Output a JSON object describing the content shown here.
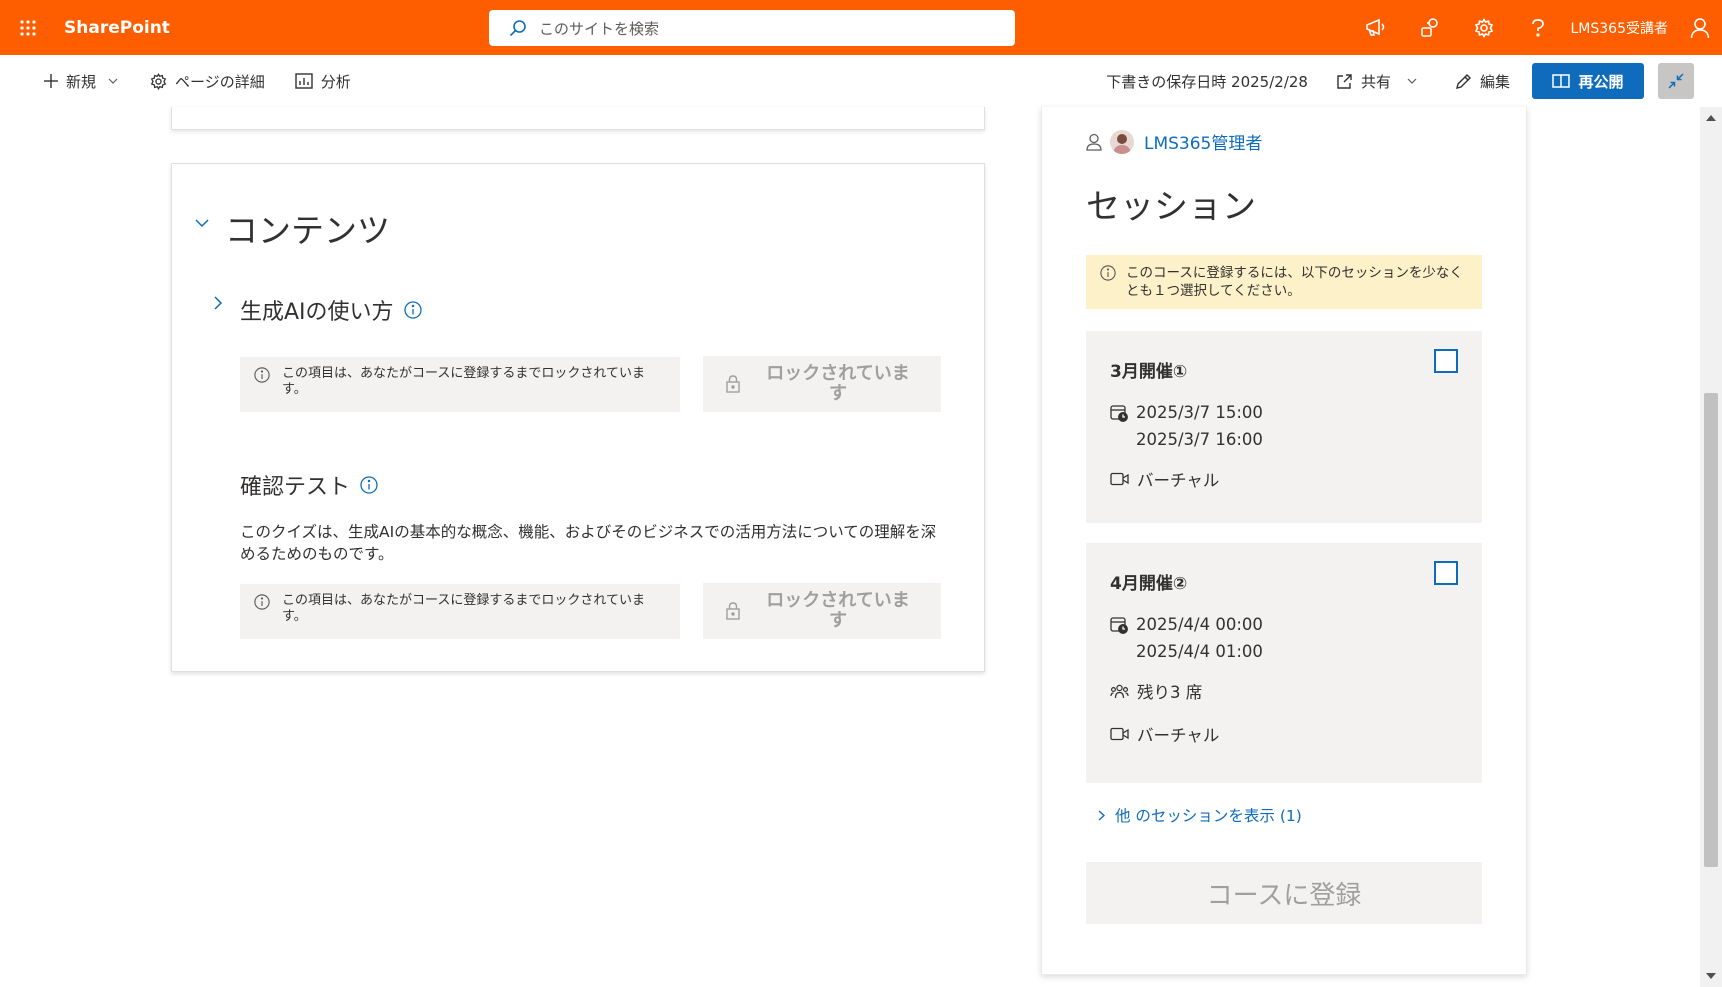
{
  "suite": {
    "app_name": "SharePoint",
    "search_placeholder": "このサイトを検索",
    "user_name": "LMS365受講者",
    "accent": "#ff5e00"
  },
  "command_bar": {
    "new_label": "新規",
    "page_details_label": "ページの詳細",
    "analytics_label": "分析",
    "draft_saved": "下書きの保存日時 2025/2/28",
    "share_label": "共有",
    "edit_label": "編集",
    "republish_label": "再公開"
  },
  "content": {
    "title": "コンテンツ",
    "items": [
      {
        "title": "生成AIの使い方",
        "lock_message": "この項目は、あなたがコースに登録するまでロックされています。",
        "lock_button": "ロックされています"
      },
      {
        "title": "確認テスト",
        "description": "このクイズは、生成AIの基本的な概念、機能、およびそのビジネスでの活用方法についての理解を深めるためのものです。",
        "lock_message": "この項目は、あなたがコースに登録するまでロックされています。",
        "lock_button": "ロックされています"
      }
    ]
  },
  "session_panel": {
    "author": "LMS365管理者",
    "title": "セッション",
    "notice": "このコースに登録するには、以下のセッションを少なくとも１つ選択してください。",
    "sessions": [
      {
        "name": "3月開催①",
        "start": "2025/3/7 15:00",
        "end": "2025/3/7 16:00",
        "location": "バーチャル"
      },
      {
        "name": "4月開催②",
        "start": "2025/4/4 00:00",
        "end": "2025/4/4 01:00",
        "seats": "残り3 席",
        "location": "バーチャル"
      }
    ],
    "more_sessions": "他 のセッションを表示 (1)",
    "enroll_button": "コースに登録"
  }
}
